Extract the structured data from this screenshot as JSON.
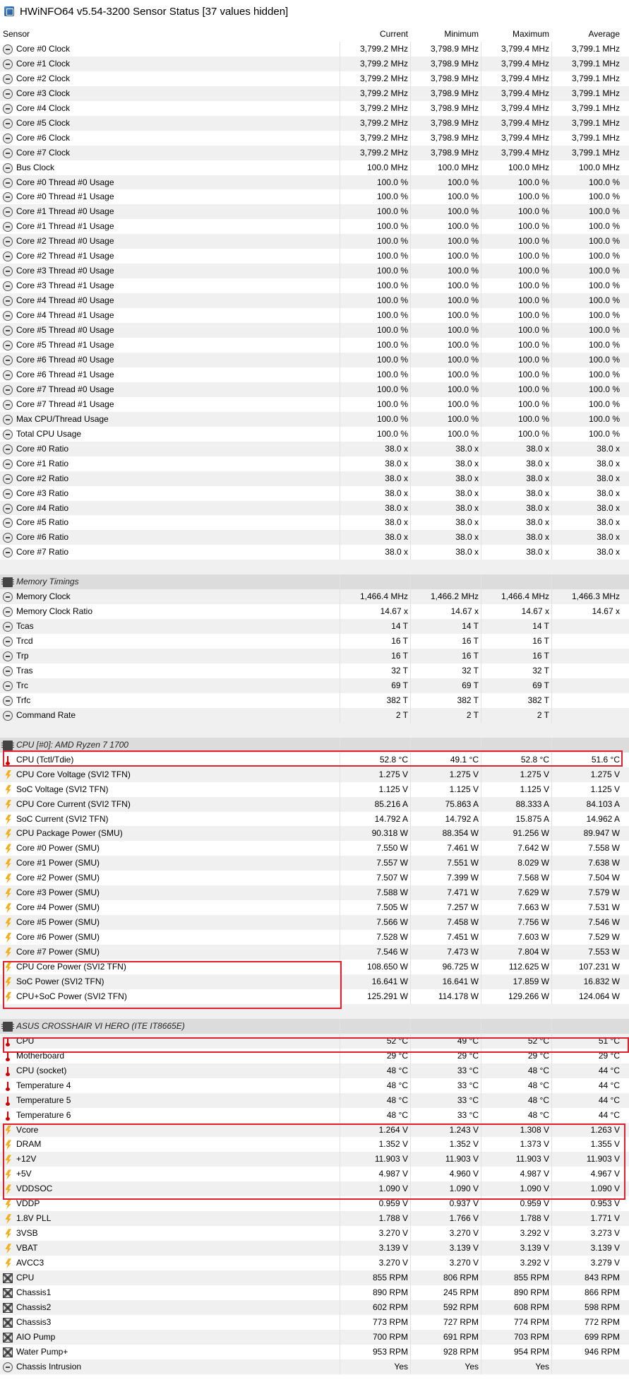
{
  "window": {
    "title": "HWiNFO64 v5.54-3200 Sensor Status [37 values hidden]"
  },
  "columns": {
    "sensor": "Sensor",
    "current": "Current",
    "minimum": "Minimum",
    "maximum": "Maximum",
    "average": "Average"
  },
  "colors": {
    "highlight": "#e0202c",
    "stripe": "#f0f0f0",
    "group_bg": "#dcdcdc"
  },
  "sections": [
    {
      "group": null,
      "rows": [
        {
          "icon": "clock-icon",
          "name": "Core #0 Clock",
          "cur": "3,799.2 MHz",
          "min": "3,798.9 MHz",
          "max": "3,799.4 MHz",
          "avg": "3,799.1 MHz"
        },
        {
          "icon": "clock-icon",
          "name": "Core #1 Clock",
          "cur": "3,799.2 MHz",
          "min": "3,798.9 MHz",
          "max": "3,799.4 MHz",
          "avg": "3,799.1 MHz"
        },
        {
          "icon": "clock-icon",
          "name": "Core #2 Clock",
          "cur": "3,799.2 MHz",
          "min": "3,798.9 MHz",
          "max": "3,799.4 MHz",
          "avg": "3,799.1 MHz"
        },
        {
          "icon": "clock-icon",
          "name": "Core #3 Clock",
          "cur": "3,799.2 MHz",
          "min": "3,798.9 MHz",
          "max": "3,799.4 MHz",
          "avg": "3,799.1 MHz"
        },
        {
          "icon": "clock-icon",
          "name": "Core #4 Clock",
          "cur": "3,799.2 MHz",
          "min": "3,798.9 MHz",
          "max": "3,799.4 MHz",
          "avg": "3,799.1 MHz"
        },
        {
          "icon": "clock-icon",
          "name": "Core #5 Clock",
          "cur": "3,799.2 MHz",
          "min": "3,798.9 MHz",
          "max": "3,799.4 MHz",
          "avg": "3,799.1 MHz"
        },
        {
          "icon": "clock-icon",
          "name": "Core #6 Clock",
          "cur": "3,799.2 MHz",
          "min": "3,798.9 MHz",
          "max": "3,799.4 MHz",
          "avg": "3,799.1 MHz"
        },
        {
          "icon": "clock-icon",
          "name": "Core #7 Clock",
          "cur": "3,799.2 MHz",
          "min": "3,798.9 MHz",
          "max": "3,799.4 MHz",
          "avg": "3,799.1 MHz"
        },
        {
          "icon": "clock-icon",
          "name": "Bus Clock",
          "cur": "100.0 MHz",
          "min": "100.0 MHz",
          "max": "100.0 MHz",
          "avg": "100.0 MHz"
        },
        {
          "icon": "clock-icon",
          "name": "Core #0 Thread #0 Usage",
          "cur": "100.0 %",
          "min": "100.0 %",
          "max": "100.0 %",
          "avg": "100.0 %"
        },
        {
          "icon": "clock-icon",
          "name": "Core #0 Thread #1 Usage",
          "cur": "100.0 %",
          "min": "100.0 %",
          "max": "100.0 %",
          "avg": "100.0 %"
        },
        {
          "icon": "clock-icon",
          "name": "Core #1 Thread #0 Usage",
          "cur": "100.0 %",
          "min": "100.0 %",
          "max": "100.0 %",
          "avg": "100.0 %"
        },
        {
          "icon": "clock-icon",
          "name": "Core #1 Thread #1 Usage",
          "cur": "100.0 %",
          "min": "100.0 %",
          "max": "100.0 %",
          "avg": "100.0 %"
        },
        {
          "icon": "clock-icon",
          "name": "Core #2 Thread #0 Usage",
          "cur": "100.0 %",
          "min": "100.0 %",
          "max": "100.0 %",
          "avg": "100.0 %"
        },
        {
          "icon": "clock-icon",
          "name": "Core #2 Thread #1 Usage",
          "cur": "100.0 %",
          "min": "100.0 %",
          "max": "100.0 %",
          "avg": "100.0 %"
        },
        {
          "icon": "clock-icon",
          "name": "Core #3 Thread #0 Usage",
          "cur": "100.0 %",
          "min": "100.0 %",
          "max": "100.0 %",
          "avg": "100.0 %"
        },
        {
          "icon": "clock-icon",
          "name": "Core #3 Thread #1 Usage",
          "cur": "100.0 %",
          "min": "100.0 %",
          "max": "100.0 %",
          "avg": "100.0 %"
        },
        {
          "icon": "clock-icon",
          "name": "Core #4 Thread #0 Usage",
          "cur": "100.0 %",
          "min": "100.0 %",
          "max": "100.0 %",
          "avg": "100.0 %"
        },
        {
          "icon": "clock-icon",
          "name": "Core #4 Thread #1 Usage",
          "cur": "100.0 %",
          "min": "100.0 %",
          "max": "100.0 %",
          "avg": "100.0 %"
        },
        {
          "icon": "clock-icon",
          "name": "Core #5 Thread #0 Usage",
          "cur": "100.0 %",
          "min": "100.0 %",
          "max": "100.0 %",
          "avg": "100.0 %"
        },
        {
          "icon": "clock-icon",
          "name": "Core #5 Thread #1 Usage",
          "cur": "100.0 %",
          "min": "100.0 %",
          "max": "100.0 %",
          "avg": "100.0 %"
        },
        {
          "icon": "clock-icon",
          "name": "Core #6 Thread #0 Usage",
          "cur": "100.0 %",
          "min": "100.0 %",
          "max": "100.0 %",
          "avg": "100.0 %"
        },
        {
          "icon": "clock-icon",
          "name": "Core #6 Thread #1 Usage",
          "cur": "100.0 %",
          "min": "100.0 %",
          "max": "100.0 %",
          "avg": "100.0 %"
        },
        {
          "icon": "clock-icon",
          "name": "Core #7 Thread #0 Usage",
          "cur": "100.0 %",
          "min": "100.0 %",
          "max": "100.0 %",
          "avg": "100.0 %"
        },
        {
          "icon": "clock-icon",
          "name": "Core #7 Thread #1 Usage",
          "cur": "100.0 %",
          "min": "100.0 %",
          "max": "100.0 %",
          "avg": "100.0 %"
        },
        {
          "icon": "clock-icon",
          "name": "Max CPU/Thread Usage",
          "cur": "100.0 %",
          "min": "100.0 %",
          "max": "100.0 %",
          "avg": "100.0 %"
        },
        {
          "icon": "clock-icon",
          "name": "Total CPU Usage",
          "cur": "100.0 %",
          "min": "100.0 %",
          "max": "100.0 %",
          "avg": "100.0 %"
        },
        {
          "icon": "clock-icon",
          "name": "Core #0 Ratio",
          "cur": "38.0 x",
          "min": "38.0 x",
          "max": "38.0 x",
          "avg": "38.0 x"
        },
        {
          "icon": "clock-icon",
          "name": "Core #1 Ratio",
          "cur": "38.0 x",
          "min": "38.0 x",
          "max": "38.0 x",
          "avg": "38.0 x"
        },
        {
          "icon": "clock-icon",
          "name": "Core #2 Ratio",
          "cur": "38.0 x",
          "min": "38.0 x",
          "max": "38.0 x",
          "avg": "38.0 x"
        },
        {
          "icon": "clock-icon",
          "name": "Core #3 Ratio",
          "cur": "38.0 x",
          "min": "38.0 x",
          "max": "38.0 x",
          "avg": "38.0 x"
        },
        {
          "icon": "clock-icon",
          "name": "Core #4 Ratio",
          "cur": "38.0 x",
          "min": "38.0 x",
          "max": "38.0 x",
          "avg": "38.0 x"
        },
        {
          "icon": "clock-icon",
          "name": "Core #5 Ratio",
          "cur": "38.0 x",
          "min": "38.0 x",
          "max": "38.0 x",
          "avg": "38.0 x"
        },
        {
          "icon": "clock-icon",
          "name": "Core #6 Ratio",
          "cur": "38.0 x",
          "min": "38.0 x",
          "max": "38.0 x",
          "avg": "38.0 x"
        },
        {
          "icon": "clock-icon",
          "name": "Core #7 Ratio",
          "cur": "38.0 x",
          "min": "38.0 x",
          "max": "38.0 x",
          "avg": "38.0 x"
        }
      ]
    },
    {
      "group": "Memory Timings",
      "rows": [
        {
          "icon": "clock-icon",
          "name": "Memory Clock",
          "cur": "1,466.4 MHz",
          "min": "1,466.2 MHz",
          "max": "1,466.4 MHz",
          "avg": "1,466.3 MHz"
        },
        {
          "icon": "clock-icon",
          "name": "Memory Clock Ratio",
          "cur": "14.67 x",
          "min": "14.67 x",
          "max": "14.67 x",
          "avg": "14.67 x"
        },
        {
          "icon": "clock-icon",
          "name": "Tcas",
          "cur": "14 T",
          "min": "14 T",
          "max": "14 T",
          "avg": ""
        },
        {
          "icon": "clock-icon",
          "name": "Trcd",
          "cur": "16 T",
          "min": "16 T",
          "max": "16 T",
          "avg": ""
        },
        {
          "icon": "clock-icon",
          "name": "Trp",
          "cur": "16 T",
          "min": "16 T",
          "max": "16 T",
          "avg": ""
        },
        {
          "icon": "clock-icon",
          "name": "Tras",
          "cur": "32 T",
          "min": "32 T",
          "max": "32 T",
          "avg": ""
        },
        {
          "icon": "clock-icon",
          "name": "Trc",
          "cur": "69 T",
          "min": "69 T",
          "max": "69 T",
          "avg": ""
        },
        {
          "icon": "clock-icon",
          "name": "Trfc",
          "cur": "382 T",
          "min": "382 T",
          "max": "382 T",
          "avg": ""
        },
        {
          "icon": "clock-icon",
          "name": "Command Rate",
          "cur": "2 T",
          "min": "2 T",
          "max": "2 T",
          "avg": ""
        }
      ]
    },
    {
      "group": "CPU [#0]: AMD Ryzen 7 1700",
      "rows": [
        {
          "icon": "thermometer-icon",
          "name": "CPU (Tctl/Tdie)",
          "cur": "52.8 °C",
          "min": "49.1 °C",
          "max": "52.8 °C",
          "avg": "51.6 °C"
        },
        {
          "icon": "lightning-icon",
          "name": "CPU Core Voltage (SVI2 TFN)",
          "cur": "1.275 V",
          "min": "1.275 V",
          "max": "1.275 V",
          "avg": "1.275 V"
        },
        {
          "icon": "lightning-icon",
          "name": "SoC Voltage (SVI2 TFN)",
          "cur": "1.125 V",
          "min": "1.125 V",
          "max": "1.125 V",
          "avg": "1.125 V"
        },
        {
          "icon": "lightning-icon",
          "name": "CPU Core Current (SVI2 TFN)",
          "cur": "85.216 A",
          "min": "75.863 A",
          "max": "88.333 A",
          "avg": "84.103 A"
        },
        {
          "icon": "lightning-icon",
          "name": "SoC Current (SVI2 TFN)",
          "cur": "14.792 A",
          "min": "14.792 A",
          "max": "15.875 A",
          "avg": "14.962 A"
        },
        {
          "icon": "lightning-icon",
          "name": "CPU Package Power (SMU)",
          "cur": "90.318 W",
          "min": "88.354 W",
          "max": "91.256 W",
          "avg": "89.947 W"
        },
        {
          "icon": "lightning-icon",
          "name": "Core #0 Power (SMU)",
          "cur": "7.550 W",
          "min": "7.461 W",
          "max": "7.642 W",
          "avg": "7.558 W"
        },
        {
          "icon": "lightning-icon",
          "name": "Core #1 Power (SMU)",
          "cur": "7.557 W",
          "min": "7.551 W",
          "max": "8.029 W",
          "avg": "7.638 W"
        },
        {
          "icon": "lightning-icon",
          "name": "Core #2 Power (SMU)",
          "cur": "7.507 W",
          "min": "7.399 W",
          "max": "7.568 W",
          "avg": "7.504 W"
        },
        {
          "icon": "lightning-icon",
          "name": "Core #3 Power (SMU)",
          "cur": "7.588 W",
          "min": "7.471 W",
          "max": "7.629 W",
          "avg": "7.579 W"
        },
        {
          "icon": "lightning-icon",
          "name": "Core #4 Power (SMU)",
          "cur": "7.505 W",
          "min": "7.257 W",
          "max": "7.663 W",
          "avg": "7.531 W"
        },
        {
          "icon": "lightning-icon",
          "name": "Core #5 Power (SMU)",
          "cur": "7.566 W",
          "min": "7.458 W",
          "max": "7.756 W",
          "avg": "7.546 W"
        },
        {
          "icon": "lightning-icon",
          "name": "Core #6 Power (SMU)",
          "cur": "7.528 W",
          "min": "7.451 W",
          "max": "7.603 W",
          "avg": "7.529 W"
        },
        {
          "icon": "lightning-icon",
          "name": "Core #7 Power (SMU)",
          "cur": "7.546 W",
          "min": "7.473 W",
          "max": "7.804 W",
          "avg": "7.553 W"
        },
        {
          "icon": "lightning-icon",
          "name": "CPU Core Power (SVI2 TFN)",
          "cur": "108.650 W",
          "min": "96.725 W",
          "max": "112.625 W",
          "avg": "107.231 W"
        },
        {
          "icon": "lightning-icon",
          "name": "SoC Power (SVI2 TFN)",
          "cur": "16.641 W",
          "min": "16.641 W",
          "max": "17.859 W",
          "avg": "16.832 W"
        },
        {
          "icon": "lightning-icon",
          "name": "CPU+SoC Power (SVI2 TFN)",
          "cur": "125.291 W",
          "min": "114.178 W",
          "max": "129.266 W",
          "avg": "124.064 W"
        }
      ]
    },
    {
      "group": "ASUS CROSSHAIR VI HERO (ITE IT8665E)",
      "rows": [
        {
          "icon": "thermometer-icon",
          "name": "CPU",
          "cur": "52 °C",
          "min": "49 °C",
          "max": "52 °C",
          "avg": "51 °C"
        },
        {
          "icon": "thermometer-icon",
          "name": "Motherboard",
          "cur": "29 °C",
          "min": "29 °C",
          "max": "29 °C",
          "avg": "29 °C"
        },
        {
          "icon": "thermometer-icon",
          "name": "CPU (socket)",
          "cur": "48 °C",
          "min": "33 °C",
          "max": "48 °C",
          "avg": "44 °C"
        },
        {
          "icon": "thermometer-icon",
          "name": "Temperature 4",
          "cur": "48 °C",
          "min": "33 °C",
          "max": "48 °C",
          "avg": "44 °C"
        },
        {
          "icon": "thermometer-icon",
          "name": "Temperature 5",
          "cur": "48 °C",
          "min": "33 °C",
          "max": "48 °C",
          "avg": "44 °C"
        },
        {
          "icon": "thermometer-icon",
          "name": "Temperature 6",
          "cur": "48 °C",
          "min": "33 °C",
          "max": "48 °C",
          "avg": "44 °C"
        },
        {
          "icon": "lightning-icon",
          "name": "Vcore",
          "cur": "1.264 V",
          "min": "1.243 V",
          "max": "1.308 V",
          "avg": "1.263 V"
        },
        {
          "icon": "lightning-icon",
          "name": "DRAM",
          "cur": "1.352 V",
          "min": "1.352 V",
          "max": "1.373 V",
          "avg": "1.355 V"
        },
        {
          "icon": "lightning-icon",
          "name": "+12V",
          "cur": "11.903 V",
          "min": "11.903 V",
          "max": "11.903 V",
          "avg": "11.903 V"
        },
        {
          "icon": "lightning-icon",
          "name": "+5V",
          "cur": "4.987 V",
          "min": "4.960 V",
          "max": "4.987 V",
          "avg": "4.967 V"
        },
        {
          "icon": "lightning-icon",
          "name": "VDDSOC",
          "cur": "1.090 V",
          "min": "1.090 V",
          "max": "1.090 V",
          "avg": "1.090 V"
        },
        {
          "icon": "lightning-icon",
          "name": "VDDP",
          "cur": "0.959 V",
          "min": "0.937 V",
          "max": "0.959 V",
          "avg": "0.953 V"
        },
        {
          "icon": "lightning-icon",
          "name": "1.8V PLL",
          "cur": "1.788 V",
          "min": "1.766 V",
          "max": "1.788 V",
          "avg": "1.771 V"
        },
        {
          "icon": "lightning-icon",
          "name": "3VSB",
          "cur": "3.270 V",
          "min": "3.270 V",
          "max": "3.292 V",
          "avg": "3.273 V"
        },
        {
          "icon": "lightning-icon",
          "name": "VBAT",
          "cur": "3.139 V",
          "min": "3.139 V",
          "max": "3.139 V",
          "avg": "3.139 V"
        },
        {
          "icon": "lightning-icon",
          "name": "AVCC3",
          "cur": "3.270 V",
          "min": "3.270 V",
          "max": "3.292 V",
          "avg": "3.279 V"
        },
        {
          "icon": "fan-icon",
          "name": "CPU",
          "cur": "855 RPM",
          "min": "806 RPM",
          "max": "855 RPM",
          "avg": "843 RPM"
        },
        {
          "icon": "fan-icon",
          "name": "Chassis1",
          "cur": "890 RPM",
          "min": "245 RPM",
          "max": "890 RPM",
          "avg": "866 RPM"
        },
        {
          "icon": "fan-icon",
          "name": "Chassis2",
          "cur": "602 RPM",
          "min": "592 RPM",
          "max": "608 RPM",
          "avg": "598 RPM"
        },
        {
          "icon": "fan-icon",
          "name": "Chassis3",
          "cur": "773 RPM",
          "min": "727 RPM",
          "max": "774 RPM",
          "avg": "772 RPM"
        },
        {
          "icon": "fan-icon",
          "name": "AIO Pump",
          "cur": "700 RPM",
          "min": "691 RPM",
          "max": "703 RPM",
          "avg": "699 RPM"
        },
        {
          "icon": "fan-icon",
          "name": "Water Pump+",
          "cur": "953 RPM",
          "min": "928 RPM",
          "max": "954 RPM",
          "avg": "946 RPM"
        },
        {
          "icon": "clock-icon",
          "name": "Chassis Intrusion",
          "cur": "Yes",
          "min": "Yes",
          "max": "Yes",
          "avg": ""
        }
      ]
    }
  ]
}
